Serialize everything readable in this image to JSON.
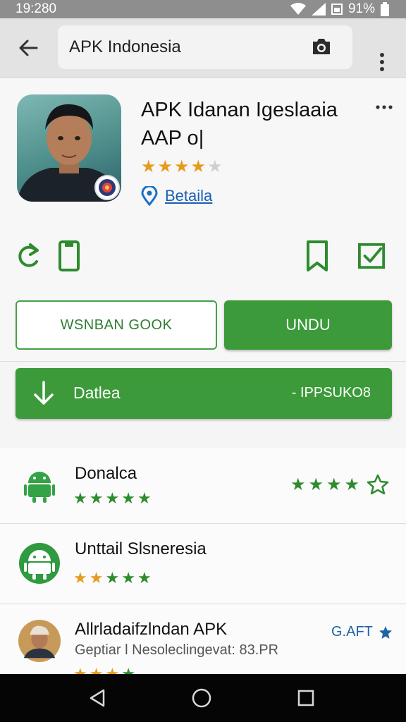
{
  "status_bar": {
    "time": "19:280",
    "battery": "91%"
  },
  "toolbar": {
    "search_value": "APK Indonesia"
  },
  "app": {
    "title_line1": "APK Idanan Igeslaaia",
    "title_line2": "AAP o|",
    "rating": 4,
    "rating_max": 5,
    "location_label": "Betaila"
  },
  "buttons": {
    "secondary_label": "WSNBAN GOOK",
    "primary_label": "UNDU"
  },
  "download": {
    "label": "Datlea",
    "size": "- IPPSUKO8"
  },
  "list": [
    {
      "title": "Donalca",
      "stars": 5,
      "star_color": "green",
      "right_rating": 4
    },
    {
      "title": "Unttail Slsneresia",
      "stars": 5,
      "star_color": "mixed"
    },
    {
      "title": "Allrladaifzlndan APK",
      "subtitle": "Geptiar l Nesoleclingevat: 83.PR",
      "action_label": "G.AFT"
    }
  ],
  "colors": {
    "accent_green": "#3c9a3a",
    "link_blue": "#1a5fb4",
    "star_orange": "#e69a1f",
    "nav_black": "#050505"
  }
}
